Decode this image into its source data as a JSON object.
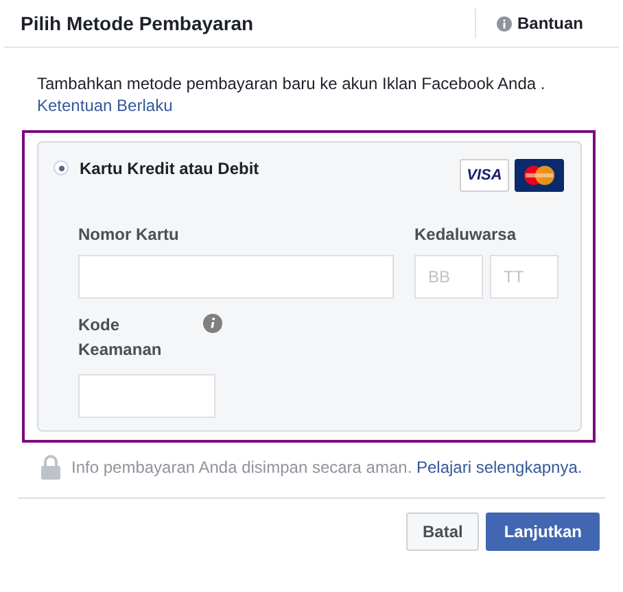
{
  "dialog": {
    "title": "Pilih Metode Pembayaran",
    "help": "Bantuan"
  },
  "intro": {
    "text": "Tambahkan metode pembayaran baru ke akun Iklan Facebook Anda .",
    "link": "Ketentuan Berlaku"
  },
  "methods": [
    {
      "label": "Kartu Kredit atau Debit",
      "selected": true,
      "logo_text": "VISA"
    }
  ],
  "form": {
    "card_number": {
      "label": "Nomor Kartu"
    },
    "expiry": {
      "label": "Kedaluwarsa",
      "month_placeholder": "BB",
      "year_placeholder": "TT"
    },
    "security_code": {
      "label_lines": [
        "Kode",
        "Keamanan"
      ]
    }
  },
  "security_note": {
    "text": "Info pembayaran Anda disimpan secara aman.",
    "link": "Pelajari selengkapnya."
  },
  "buttons": [
    {
      "label": "Batal",
      "kind": "secondary"
    },
    {
      "label": "Lanjutkan",
      "kind": "primary"
    }
  ]
}
